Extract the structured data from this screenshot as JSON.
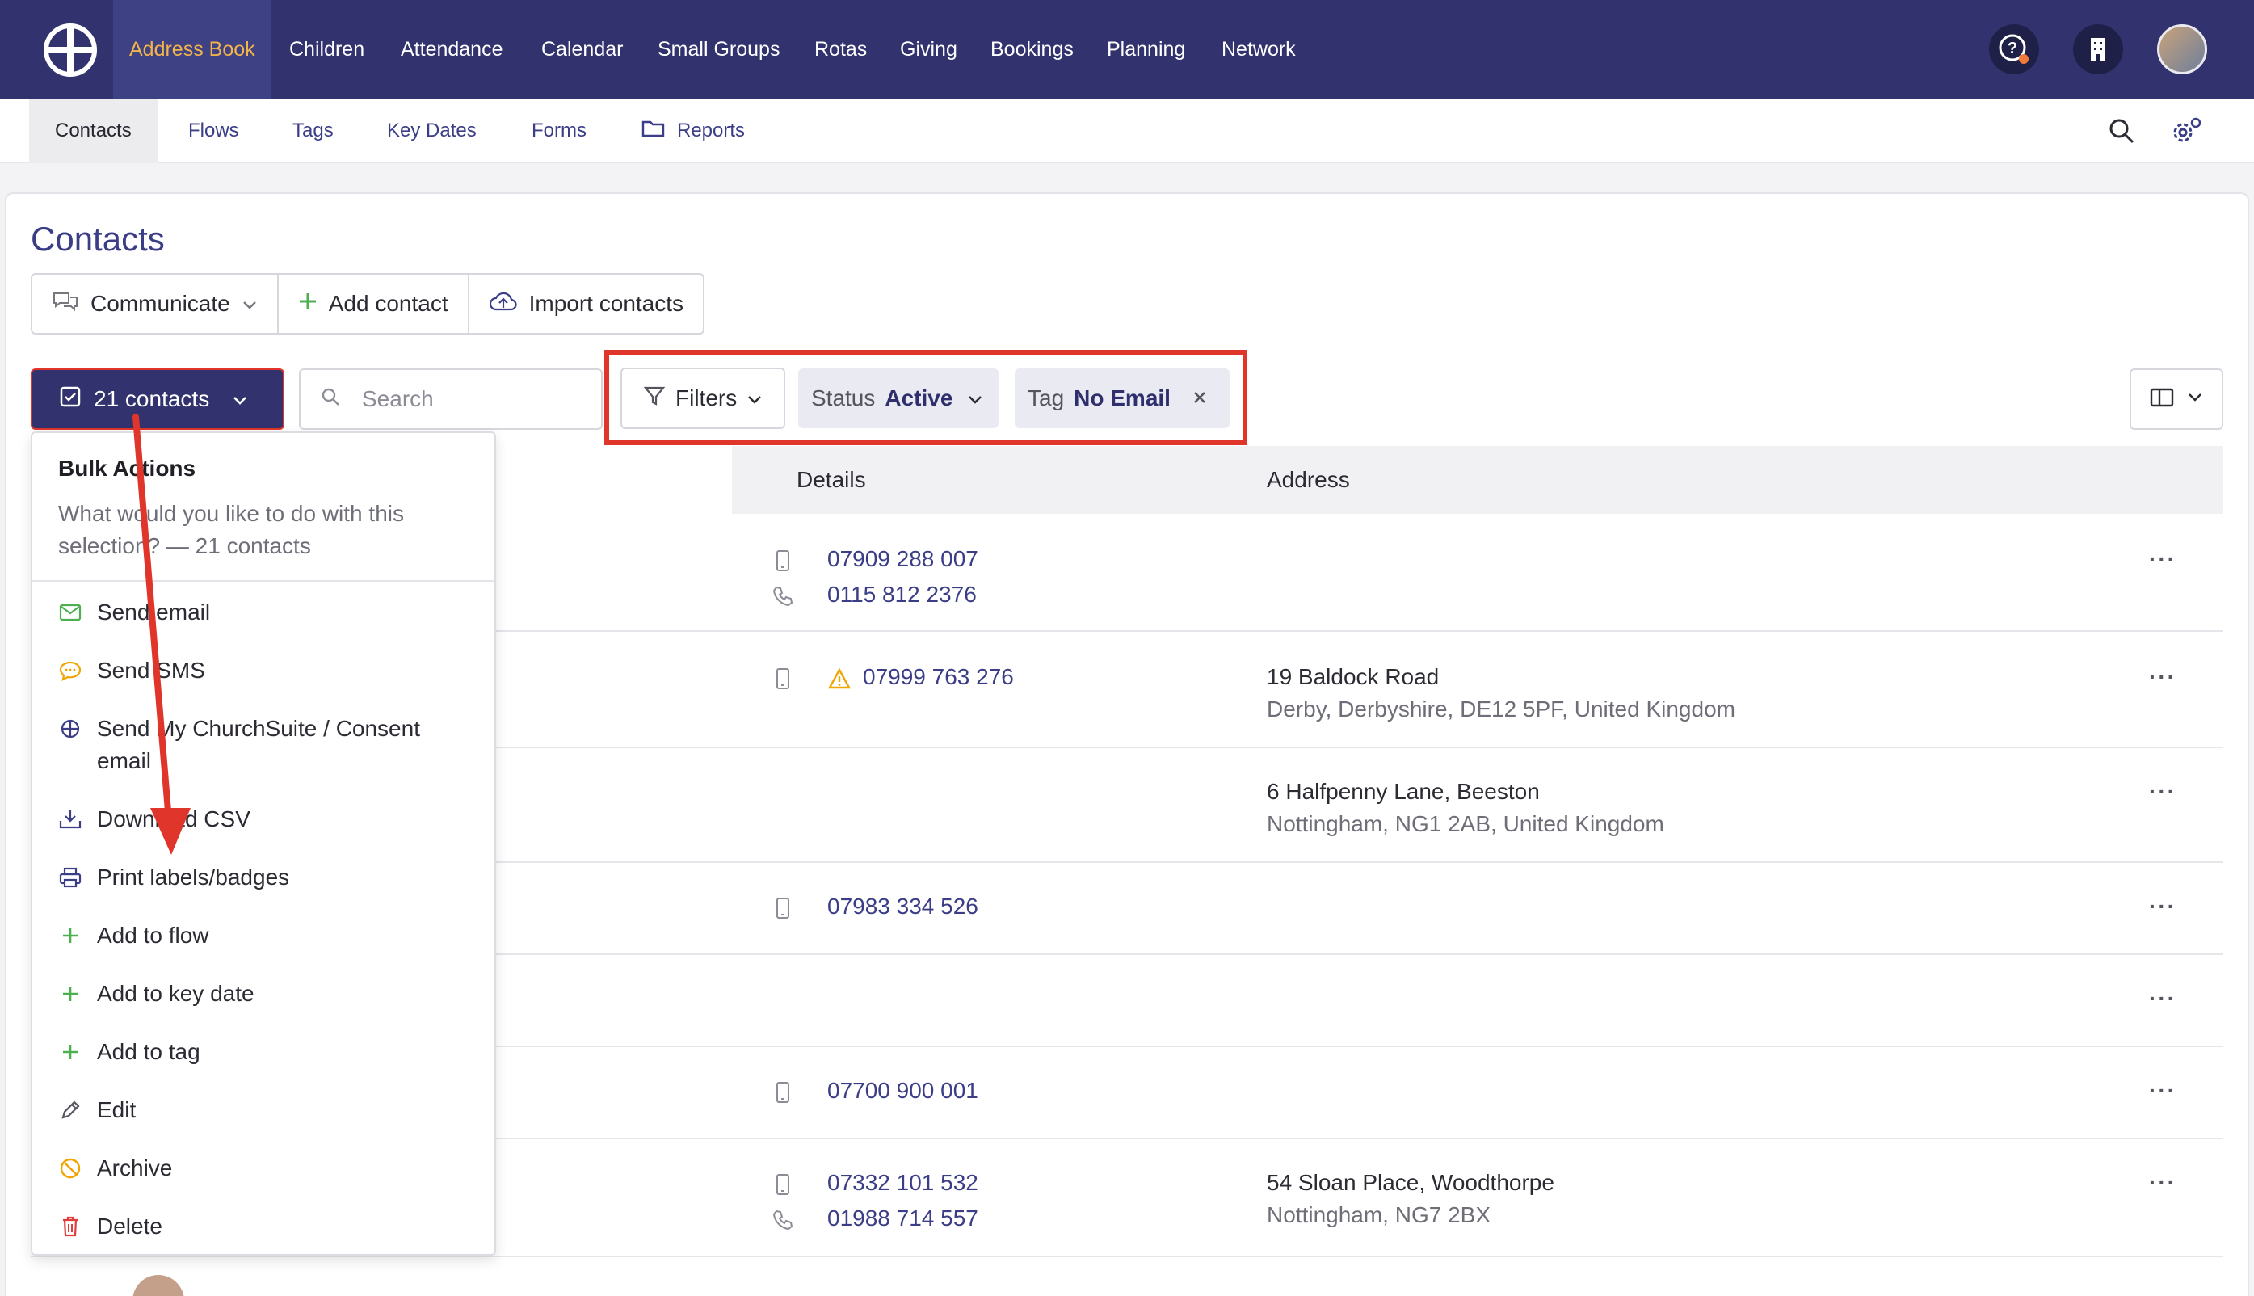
{
  "topnav": {
    "items": [
      "Address Book",
      "Children",
      "Attendance",
      "Calendar",
      "Small Groups",
      "Rotas",
      "Giving",
      "Bookings",
      "Planning",
      "Network"
    ],
    "active": "Address Book"
  },
  "subnav": {
    "items": [
      "Contacts",
      "Flows",
      "Tags",
      "Key Dates",
      "Forms",
      "Reports"
    ],
    "active": "Contacts"
  },
  "page": {
    "title": "Contacts",
    "actions": {
      "communicate": "Communicate",
      "add_contact": "Add contact",
      "import_contacts": "Import contacts"
    },
    "selection": "21 contacts",
    "search_placeholder": "Search",
    "filters_label": "Filters",
    "chips": [
      {
        "key": "Status",
        "value": "Active"
      },
      {
        "key": "Tag",
        "value": "No Email"
      }
    ]
  },
  "table": {
    "headers": {
      "details": "Details",
      "address": "Address"
    },
    "rows": [
      {
        "mobile": "07909 288 007",
        "phone": "0115 812 2376",
        "address1": "",
        "address2": ""
      },
      {
        "mobile": "07999 763 276",
        "phone": "",
        "address1": "19 Baldock Road",
        "address2": "Derby, Derbyshire, DE12 5PF, United Kingdom"
      },
      {
        "mobile": "",
        "phone": "",
        "address1": "6 Halfpenny Lane, Beeston",
        "address2": "Nottingham, NG1 2AB, United Kingdom"
      },
      {
        "mobile": "07983 334 526",
        "phone": "",
        "address1": "",
        "address2": ""
      },
      {
        "mobile": "",
        "phone": "",
        "address1": "",
        "address2": ""
      },
      {
        "mobile": "07700 900 001",
        "phone": "",
        "address1": "",
        "address2": ""
      },
      {
        "mobile": "07332 101 532",
        "phone": "01988 714 557",
        "address1": "54 Sloan Place, Woodthorpe",
        "address2": "Nottingham, NG7 2BX"
      }
    ],
    "more": "···"
  },
  "bulk": {
    "title": "Bulk Actions",
    "description": "What would you like to do with this selection? — 21 contacts",
    "items": [
      "Send email",
      "Send SMS",
      "Send My ChurchSuite / Consent email",
      "Download CSV",
      "Print labels/badges",
      "Add to flow",
      "Add to key date",
      "Add to tag",
      "Edit",
      "Archive",
      "Delete"
    ]
  },
  "colors": {
    "nav_bg": "#31326e",
    "accent": "#3b3d86",
    "active_nav_text": "#f3b44a",
    "annotation_red": "#e0352b",
    "green": "#4caf50",
    "orange": "#f0a500",
    "red": "#e23b3b"
  }
}
